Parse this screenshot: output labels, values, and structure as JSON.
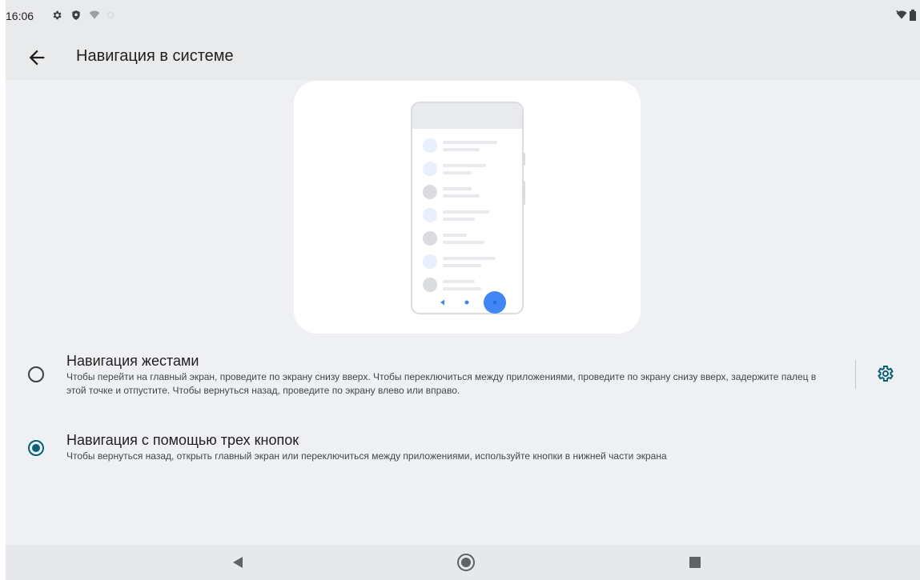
{
  "status_bar": {
    "time": "16:06",
    "icons_left": [
      "settings-icon",
      "shield-icon",
      "wifi-question-icon",
      "data-saver-icon"
    ],
    "icons_right": [
      "wifi-icon",
      "battery-icon"
    ]
  },
  "app_bar": {
    "title": "Навигация в системе",
    "back_icon": "arrow-left-icon"
  },
  "illustration": {
    "accent_color": "#4285f4",
    "list_rows": 7
  },
  "options": [
    {
      "title": "Навигация жестами",
      "description": "Чтобы перейти на главный экран, проведите по экрану снизу вверх. Чтобы переключиться между приложениями, проведите по экрану снизу вверх, задержите палец в этой точке и отпустите. Чтобы вернуться назад, проведите по экрану влево или вправо.",
      "selected": false,
      "settings_icon": "gear-icon"
    },
    {
      "title": "Навигация с помощью трех кнопок",
      "description": "Чтобы вернуться назад, открыть главный экран или переключиться между приложениями, используйте кнопки в нижней части экрана",
      "selected": true
    }
  ],
  "nav_bar": {
    "buttons": [
      "back-triangle-icon",
      "home-circle-icon",
      "recents-square-icon"
    ]
  },
  "colors": {
    "accent": "#0b5f75",
    "background": "#eef0f3",
    "card": "#ffffff"
  }
}
